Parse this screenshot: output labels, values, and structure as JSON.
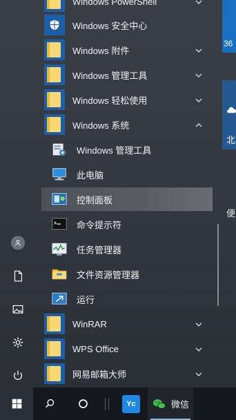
{
  "start_menu": {
    "apps": [
      {
        "label": "Windows PowerShell",
        "icon": "folder-icon",
        "has_chevron": true
      },
      {
        "label": "Windows 安全中心",
        "icon": "shield-icon",
        "has_chevron": false
      },
      {
        "label": "Windows 附件",
        "icon": "folder-icon",
        "has_chevron": true
      },
      {
        "label": "Windows 管理工具",
        "icon": "folder-icon",
        "has_chevron": true
      },
      {
        "label": "Windows 轻松使用",
        "icon": "folder-icon",
        "has_chevron": true
      },
      {
        "label": "Windows 系统",
        "icon": "folder-icon",
        "has_chevron": true,
        "expanded": true
      },
      {
        "label": "Windows 管理工具",
        "icon": "admin-tools-icon",
        "sub": true
      },
      {
        "label": "此电脑",
        "icon": "computer-icon",
        "sub": true
      },
      {
        "label": "控制面板",
        "icon": "control-panel-icon",
        "sub": true,
        "selected": true
      },
      {
        "label": "命令提示符",
        "icon": "cmd-icon",
        "sub": true
      },
      {
        "label": "任务管理器",
        "icon": "task-manager-icon",
        "sub": true
      },
      {
        "label": "文件资源管理器",
        "icon": "file-explorer-icon",
        "sub": true
      },
      {
        "label": "运行",
        "icon": "run-icon",
        "sub": true
      },
      {
        "label": "WinRAR",
        "icon": "folder-icon",
        "has_chevron": true
      },
      {
        "label": "WPS Office",
        "icon": "folder-icon",
        "has_chevron": true
      },
      {
        "label": "网易邮箱大师",
        "icon": "folder-icon",
        "has_chevron": true
      }
    ]
  },
  "right_edge": {
    "tile_top_text": "36",
    "tile_weather_text": "北",
    "tile_partial_text": "便"
  },
  "taskbar": {
    "wechat_label": "微信",
    "yc_label": "Yc"
  },
  "colors": {
    "accent": "#1a5fa8",
    "folder": "#f7d875",
    "taskbar": "#15181d"
  }
}
